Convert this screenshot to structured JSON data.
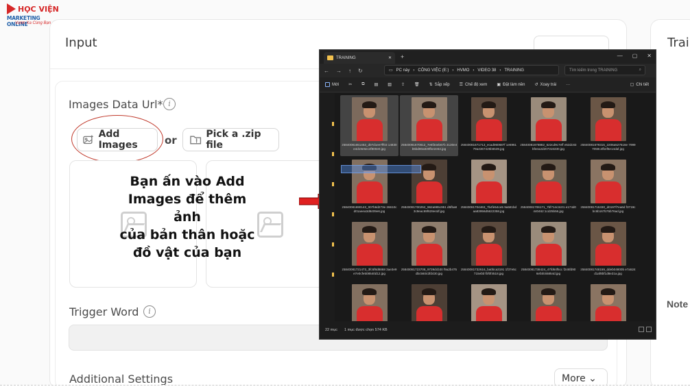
{
  "logo": {
    "line1": "HỌC VIỆN",
    "line2": "MARKETING ONLINE",
    "line3": "Vươn Xa Cùng Bạn"
  },
  "app": {
    "input_title": "Input",
    "training_title": "Trai",
    "note_title": "Note",
    "images_label": "Images Data Url*",
    "add_images": "Add Images",
    "or": "or",
    "pick_zip": "Pick a .zip file",
    "trigger_label": "Trigger Word",
    "additional_label": "Additional Settings",
    "more_btn": "More ⌄"
  },
  "annotation": {
    "line1": "Bạn ấn vào Add",
    "line2": "Images để thêm ảnh",
    "line3": "của bản thân hoặc",
    "line4": "đồ vật của bạn",
    "arrow_color": "#e02020",
    "circle_color": "#c0392b"
  },
  "explorer": {
    "tab_title": "TRAINING",
    "window_controls": [
      "—",
      "▢",
      "✕"
    ],
    "path": [
      "PC này",
      "CÔNG VIỆC (E:)",
      "HVMO",
      "VIDEO 38",
      "TRAINING"
    ],
    "search_placeholder": "Tìm kiếm trong TRAINING",
    "commands": [
      "Mới",
      "Sắp xếp",
      "Chế độ xem",
      "Đặt làm nền",
      "Xoay trái",
      "···"
    ],
    "detail": "Chi tiết",
    "files": [
      {
        "name": "z5840081651453_d07d1ee7ff03 14830e4d19e6ec4f800e0.jpg",
        "selected": true
      },
      {
        "name": "z5840081670812_7e6f34eb67b 3130e4b5bd80a830fbe2e62.jpg",
        "selected": true
      },
      {
        "name": "z5840081671713_ecad060687f 1e696179a4367425b6539.jpg",
        "selected": false
      },
      {
        "name": "z5840081678882_522cd9c7eff e53dc83bfeea2d207316330.jpg",
        "selected": false
      },
      {
        "name": "z5840081679315_2206a527516e 79997059c4fb4f6e14daf.jpg",
        "selected": false
      },
      {
        "name": "z5840081690143_007b6d273e 26610cd01aeea3d8409e6.jpg",
        "selected": false
      },
      {
        "name": "z5840081700252_962a985c951 d5fba83c9eac69f628e4df.jpg",
        "selected": false
      },
      {
        "name": "z5840081704463_7b4fe54ce5 9a581bdaa83956d5622358.jpg",
        "selected": false
      },
      {
        "name": "z5840081706171_7bf714c3c01 e174d0440462:1cd25b56.jpg",
        "selected": false
      },
      {
        "name": "z5840081715330_d0197f7ea6d f3719cbc6b167b75b76ad.jpg",
        "selected": false
      },
      {
        "name": "z5840081721473_3fc5f8d8868 3ae3e9e7e0cfe508540d12.jpg",
        "selected": false
      },
      {
        "name": "z5840081723708_9739dcb30 f9a2b475dbc56043fd430.jpg",
        "selected": false
      },
      {
        "name": "z5840081732616_ba0bca3191 1f37e5c715ebb7bf0f4518.jpg",
        "selected": false
      },
      {
        "name": "z5840081738424_47fd64f5cc f246fd906efafc65854d.jpg",
        "selected": false
      },
      {
        "name": "z5840081748159_ddeb04800b e7a524d1af8bf1d8e21a.jpg",
        "selected": false
      },
      {
        "name": "",
        "selected": false
      },
      {
        "name": "",
        "selected": false
      },
      {
        "name": "",
        "selected": false
      },
      {
        "name": "",
        "selected": false
      },
      {
        "name": "",
        "selected": false
      }
    ],
    "status_count": "22 mục",
    "status_selected": "1 mục được chọn 574 KB"
  }
}
